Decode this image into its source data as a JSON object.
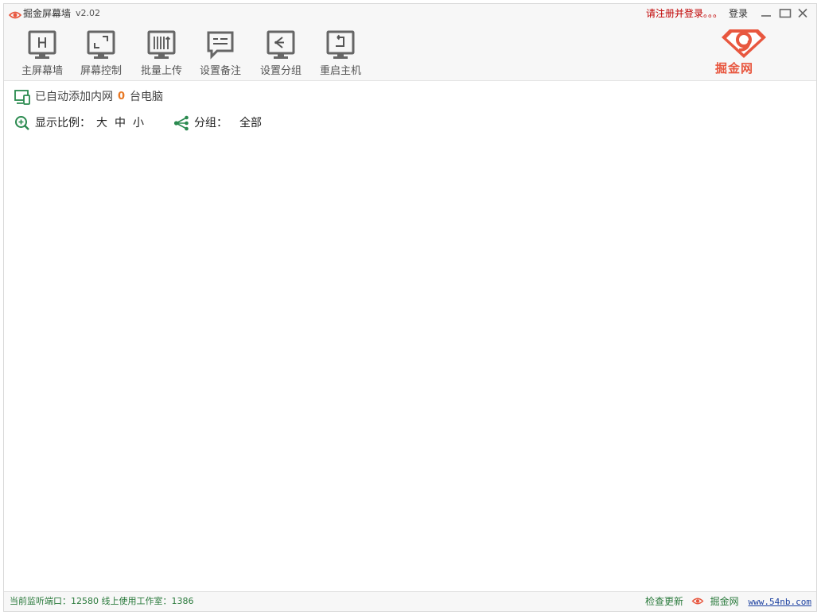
{
  "window": {
    "title": "掘金屏幕墙",
    "version": "v2.02",
    "register_text": "请注册并登录。。。",
    "login_label": "登录"
  },
  "toolbar": {
    "buttons": [
      {
        "label": "主屏幕墙",
        "icon": "monitor-h-icon"
      },
      {
        "label": "屏幕控制",
        "icon": "monitor-expand-icon"
      },
      {
        "label": "批量上传",
        "icon": "upload-icon"
      },
      {
        "label": "设置备注",
        "icon": "comment-icon"
      },
      {
        "label": "设置分组",
        "icon": "group-icon"
      },
      {
        "label": "重启主机",
        "icon": "restart-icon"
      }
    ],
    "logo_text": "掘金网"
  },
  "main": {
    "info_prefix": "已自动添加内网",
    "pc_count": "0",
    "info_suffix": "台电脑",
    "scale_label": "显示比例：",
    "scale_options": [
      "大",
      "中",
      "小"
    ],
    "group_label": "分组：",
    "group_value": "全部"
  },
  "status": {
    "port_label": "当前监听端口：",
    "port_value": "12580",
    "online_label": "线上使用工作室：",
    "online_value": "1386",
    "update_label": "检查更新",
    "site_label": "掘金网",
    "url": "www.54nb.com"
  },
  "colors": {
    "accent_green": "#2a8a4f",
    "brand_red": "#e8573f",
    "count_orange": "#e87722",
    "register_red": "#c00000"
  }
}
